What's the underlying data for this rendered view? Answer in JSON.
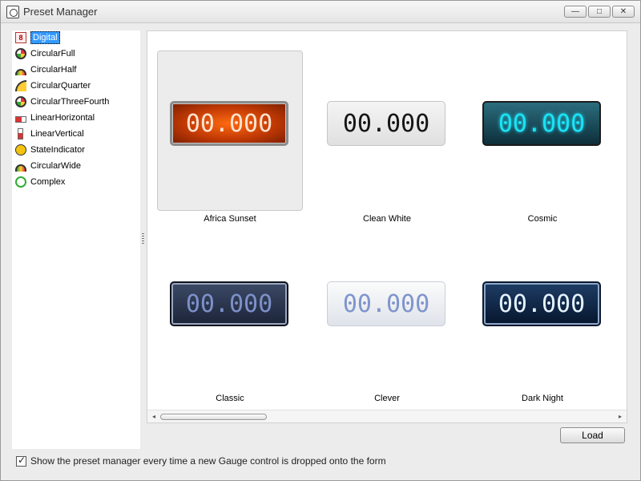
{
  "window": {
    "title": "Preset Manager",
    "controls": {
      "minimize": "—",
      "maximize": "□",
      "close": "✕"
    }
  },
  "sidebar": {
    "items": [
      {
        "label": "Digital",
        "icon": "digital-gauge-icon",
        "selected": true
      },
      {
        "label": "CircularFull",
        "icon": "circular-full-gauge-icon"
      },
      {
        "label": "CircularHalf",
        "icon": "circular-half-gauge-icon"
      },
      {
        "label": "CircularQuarter",
        "icon": "circular-quarter-gauge-icon"
      },
      {
        "label": "CircularThreeFourth",
        "icon": "circular-three-fourth-gauge-icon"
      },
      {
        "label": "LinearHorizontal",
        "icon": "linear-horizontal-gauge-icon"
      },
      {
        "label": "LinearVertical",
        "icon": "linear-vertical-gauge-icon"
      },
      {
        "label": "StateIndicator",
        "icon": "state-indicator-icon"
      },
      {
        "label": "CircularWide",
        "icon": "circular-wide-gauge-icon"
      },
      {
        "label": "Complex",
        "icon": "complex-gauge-icon"
      }
    ]
  },
  "presets": [
    {
      "label": "Africa Sunset",
      "readout": "00.000",
      "selected": true
    },
    {
      "label": "Clean White",
      "readout": "00.000"
    },
    {
      "label": "Cosmic",
      "readout": "00.000"
    },
    {
      "label": "Classic",
      "readout": "00.000"
    },
    {
      "label": "Clever",
      "readout": "00.000"
    },
    {
      "label": "Dark Night",
      "readout": "00.000"
    }
  ],
  "scrollbar": {
    "left_arrow": "◂",
    "right_arrow": "▸"
  },
  "actions": {
    "load_label": "Load"
  },
  "footer": {
    "checkbox_checked": true,
    "checkbox_label": "Show the preset manager every time a new Gauge control is dropped onto the form"
  }
}
